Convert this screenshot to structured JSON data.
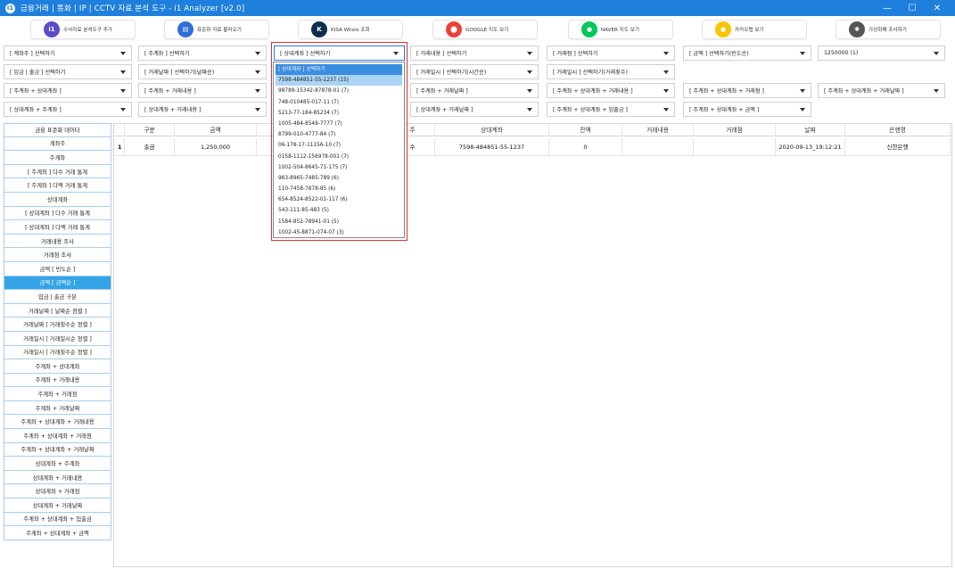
{
  "window": {
    "title": "금융거래 | 통화 | IP | CCTV 자료 분석 도구 - i1 Analyzer [v2.0]",
    "app_icon": "i1",
    "controls": [
      "—",
      "☐",
      "✕"
    ]
  },
  "toolbar": [
    {
      "label": "수사자료 분석도구 추가",
      "icon": "analyzer-icon",
      "color": "#5b4ccc",
      "glyph": "i1"
    },
    {
      "label": "표준화 자료 불러오기",
      "icon": "document-icon",
      "color": "#2f6fd8",
      "glyph": "▤"
    },
    {
      "label": "KISA Whois 조회",
      "icon": "kisa-icon",
      "color": "#0d2d4e",
      "glyph": "K"
    },
    {
      "label": "GOOGLE 지도 보기",
      "icon": "google-map-icon",
      "color": "#e94235",
      "glyph": "⬤"
    },
    {
      "label": "NAVER 지도 보기",
      "icon": "naver-map-icon",
      "color": "#03c75a",
      "glyph": "●"
    },
    {
      "label": "카카오맵 보기",
      "icon": "kakao-map-icon",
      "color": "#f7c600",
      "glyph": "●"
    },
    {
      "label": "가상화폐 조사하기",
      "icon": "crypto-icon",
      "color": "#555555",
      "glyph": "✺"
    }
  ],
  "filters": {
    "row1": [
      "[ 계좌주 ] 선택하기",
      "[ 주계좌 ] 선택하기",
      "[ 상대계좌 ] 선택하기",
      "[ 거래내용 ] 선택하기",
      "[ 거래점 ] 선택하기",
      "[ 금액 ] 선택하기(빈도순)",
      "1250000 (1)"
    ],
    "row2": [
      "[ 입금 | 출금 ] 선택하기",
      "[ 거래날짜 ] 선택하기(날짜순)",
      "[ 거래일시 ] 선택하기(시간순)",
      "[ 거래일시 ] 선택하기(거래횟수)"
    ],
    "row3": [
      "[ 주계좌 + 상대계좌 ]",
      "[ 주계좌 + 거래내용 ]",
      "[ 주계좌 + 거래날짜 ]",
      "[ 주계좌 + 상대계좌 + 거래내용 ]",
      "[ 주계좌 + 상대계좌 + 거래점 ]",
      "[ 주계좌 + 상대계좌 + 거래날짜 ]"
    ],
    "row4": [
      "[ 상대계좌 + 주계좌 ]",
      "[ 상대계좌 + 거래내용 ]",
      "[ 상대계좌 + 거래날짜 ]",
      "[ 주계좌 + 상대계좌 + 입출금 ]",
      "[ 주계좌 + 상대계좌 + 금액 ]"
    ]
  },
  "dropdown": {
    "items": [
      "[ 상대계좌 ] 선택하기",
      "7598-484851-55-1237 (15)",
      "98789-15342-87878-01 (7)",
      "748-010485-017-11 (7)",
      "5213-77-184-85234 (7)",
      "1005-484-8549-7777 (7)",
      "8799-010-4777-84 (7)",
      "06-178-17-11156-10 (7)",
      "0158-1112-156978-001 (7)",
      "1002-504-8645-71-175 (7)",
      "963-8965-7485-789 (6)",
      "110-7458-7878-85 (6)",
      "654-8524-8522-01-117 (6)",
      "543-111-85-483 (5)",
      "1584-852-78941-01 (5)",
      "1002-45-8871-074-07 (3)"
    ],
    "selected_index": 1
  },
  "nav": {
    "items": [
      "금융 표준화 데이터",
      "계좌주",
      "주계좌",
      "[ 주계좌 ] 다수 거래 통계",
      "[ 주계좌 ] 다액 거래 통계",
      "상대계좌",
      "[ 상대계좌 ] 다수 거래 통계",
      "[ 상대계좌 ] 다액 거래 통계",
      "거래내용 조사",
      "거래점 조사",
      "금액 [ 빈도순 ]",
      "금액 [ 금액순 ]",
      "입금 | 출금 구분",
      "거래날짜 [ 날짜순 정렬 ]",
      "거래날짜 [ 거래횟수순 정렬 ]",
      "거래일시 [ 거래일시순 정렬 ]",
      "거래일시 [ 거래횟수순 정렬 ]",
      "주계좌 + 상대계좌",
      "주계좌 + 거래내용",
      "주계좌 + 거래점",
      "주계좌 + 거래날짜",
      "주계좌 + 상대계좌 + 거래내용",
      "주계좌 + 상대계좌 + 거래점",
      "주계좌 + 상대계좌 + 거래날짜",
      "상대계좌 + 주계좌",
      "상대계좌 + 거래내용",
      "상대계좌 + 거래점",
      "상대계좌 + 거래날짜",
      "주계좌 + 상대계좌 + 입출금",
      "주계좌 + 상대계좌 + 금액"
    ],
    "active_index": 11
  },
  "table": {
    "columns": [
      "",
      "구분",
      "금액",
      "주",
      "상대계좌",
      "잔액",
      "거래내용",
      "거래점",
      "날짜",
      "은행명"
    ],
    "rows": [
      [
        "1",
        "출금",
        "1,250,000",
        "수",
        "7598-484851-55-1237",
        "0",
        "",
        "",
        "2020-09-13_19:12:21",
        "신한은행"
      ]
    ]
  }
}
